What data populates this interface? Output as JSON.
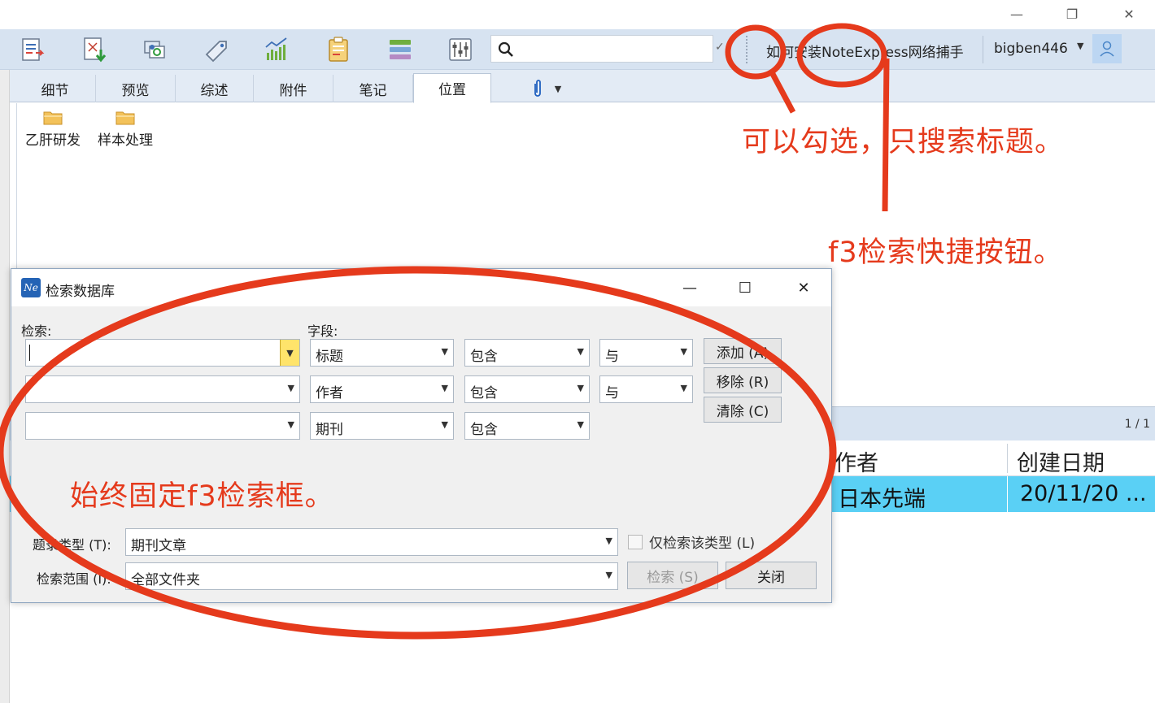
{
  "window": {
    "minimize_glyph": "—",
    "restore_glyph": "❐",
    "close_glyph": "✕"
  },
  "toolbar": {
    "buttons": [
      {
        "icon": "import-icon"
      },
      {
        "icon": "download-icon"
      },
      {
        "icon": "sync-icon"
      },
      {
        "icon": "tag-icon"
      },
      {
        "icon": "analysis-icon"
      },
      {
        "icon": "clipboard-icon"
      },
      {
        "icon": "stack-icon"
      },
      {
        "icon": "settings-sliders-icon"
      }
    ],
    "search": {
      "value": "",
      "placeholder": ""
    },
    "help_link": "如何安装NoteExpress网络捕手",
    "user_name": "bigben446"
  },
  "tabs": [
    {
      "label": "细节",
      "active": false
    },
    {
      "label": "预览",
      "active": false
    },
    {
      "label": "综述",
      "active": false
    },
    {
      "label": "附件",
      "active": false
    },
    {
      "label": "笔记",
      "active": false
    },
    {
      "label": "位置",
      "active": true
    }
  ],
  "folders": [
    {
      "label": "乙肝研发"
    },
    {
      "label": "样本处理"
    }
  ],
  "list": {
    "page_count": "1 / 1",
    "columns": [
      "作者",
      "创建日期"
    ],
    "rows": [
      {
        "author": "日本先端",
        "created": "20/11/20 ..."
      }
    ]
  },
  "dialog": {
    "title": "检索数据库",
    "labels": {
      "search": "检索:",
      "field": "字段:",
      "record_type": "题录类型 (T):",
      "scope": "检索范围 (I):",
      "only_type": "仅检索该类型 (L)"
    },
    "rows": [
      {
        "term": "",
        "field": "标题",
        "op": "包含",
        "logic": "与"
      },
      {
        "term": "",
        "field": "作者",
        "op": "包含",
        "logic": "与"
      },
      {
        "term": "",
        "field": "期刊",
        "op": "包含",
        "logic": ""
      }
    ],
    "buttons": {
      "add": "添加 (A)",
      "remove": "移除 (R)",
      "clear": "清除 (C)",
      "search": "检索 (S)",
      "close": "关闭"
    },
    "record_type_value": "期刊文章",
    "scope_value": "全部文件夹",
    "only_type_checked": false
  },
  "annotations": {
    "checkbox_note": "可以勾选，只搜索标题。",
    "f3_note": "f3检索快捷按钮。",
    "dialog_note": "始终固定f3检索框。",
    "color": "#e53a1c"
  }
}
